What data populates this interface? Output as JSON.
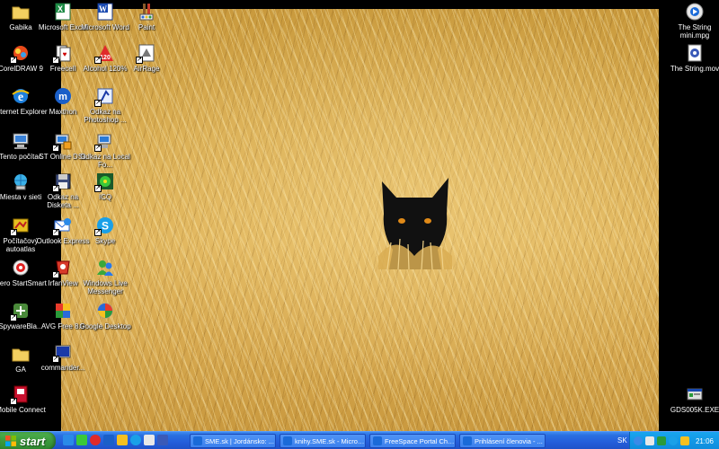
{
  "desktop": {
    "icons_col1": [
      {
        "label": "Gabika",
        "icon": "folder-icon"
      },
      {
        "label": "CorelDRAW 9",
        "icon": "coreldraw-icon"
      },
      {
        "label": "Internet Explorer",
        "icon": "internet-explorer-icon"
      },
      {
        "label": "Tento počítač",
        "icon": "my-computer-icon"
      },
      {
        "label": "Miesta v sieti",
        "icon": "network-places-icon"
      },
      {
        "label": "Počítačový autoatlas",
        "icon": "autoatlas-icon"
      },
      {
        "label": "Nero StartSmart",
        "icon": "nero-icon"
      },
      {
        "label": "SpywareBla...",
        "icon": "spywareblaster-icon"
      },
      {
        "label": "GA",
        "icon": "folder-icon"
      },
      {
        "label": "Mobile Connect",
        "icon": "mobile-connect-icon"
      }
    ],
    "icons_col2": [
      {
        "label": "Microsoft Excel",
        "icon": "excel-icon"
      },
      {
        "label": "Freecell",
        "icon": "freecell-icon"
      },
      {
        "label": "Maxthon",
        "icon": "maxthon-icon"
      },
      {
        "label": "ST Online DSL",
        "icon": "st-online-dsl-icon"
      },
      {
        "label": "Odkaz na Disketa ...",
        "icon": "floppy-shortcut-icon"
      },
      {
        "label": "Outlook Express",
        "icon": "outlook-express-icon"
      },
      {
        "label": "IrfanView",
        "icon": "irfanview-icon"
      },
      {
        "label": "AVG Free 8.0",
        "icon": "avg-icon"
      },
      {
        "label": "commander...",
        "icon": "commander-icon"
      }
    ],
    "icons_col3": [
      {
        "label": "Microsoft Word",
        "icon": "word-icon"
      },
      {
        "label": "Alcohol 120%",
        "icon": "alcohol-icon"
      },
      {
        "label": "Odkaz na Photoshop ...",
        "icon": "photoshop-shortcut-icon"
      },
      {
        "label": "Odkaz na Local Fo...",
        "icon": "local-folder-shortcut-icon"
      },
      {
        "label": "ICQ",
        "icon": "icq-icon"
      },
      {
        "label": "Skype",
        "icon": "skype-icon"
      },
      {
        "label": "Windows Live Messenger",
        "icon": "messenger-icon"
      },
      {
        "label": "Google Desktop",
        "icon": "google-desktop-icon"
      }
    ],
    "icons_col4": [
      {
        "label": "Paint",
        "icon": "paint-icon"
      },
      {
        "label": "AirRage",
        "icon": "airrage-icon"
      }
    ],
    "icons_right": [
      {
        "label": "The String mini.mpg",
        "icon": "video-file-icon"
      },
      {
        "label": "The String.mov",
        "icon": "quicktime-file-icon"
      },
      {
        "label": "GDS005K.EXE",
        "icon": "exe-file-icon"
      }
    ]
  },
  "taskbar": {
    "start_label": "start",
    "tasks": [
      {
        "label": "SME.sk | Jordánsko: ..."
      },
      {
        "label": "knihy.SME.sk - Micros..."
      },
      {
        "label": "FreeSpace Portal Cha..."
      },
      {
        "label": "Prihlásení členovia - ..."
      }
    ],
    "language": "SK",
    "clock": "21:06"
  },
  "colors": {
    "taskbar_blue": "#245edb",
    "start_green": "#3c9a3c",
    "tray_blue": "#0f8bdc",
    "wheat": "#d9ad52"
  }
}
